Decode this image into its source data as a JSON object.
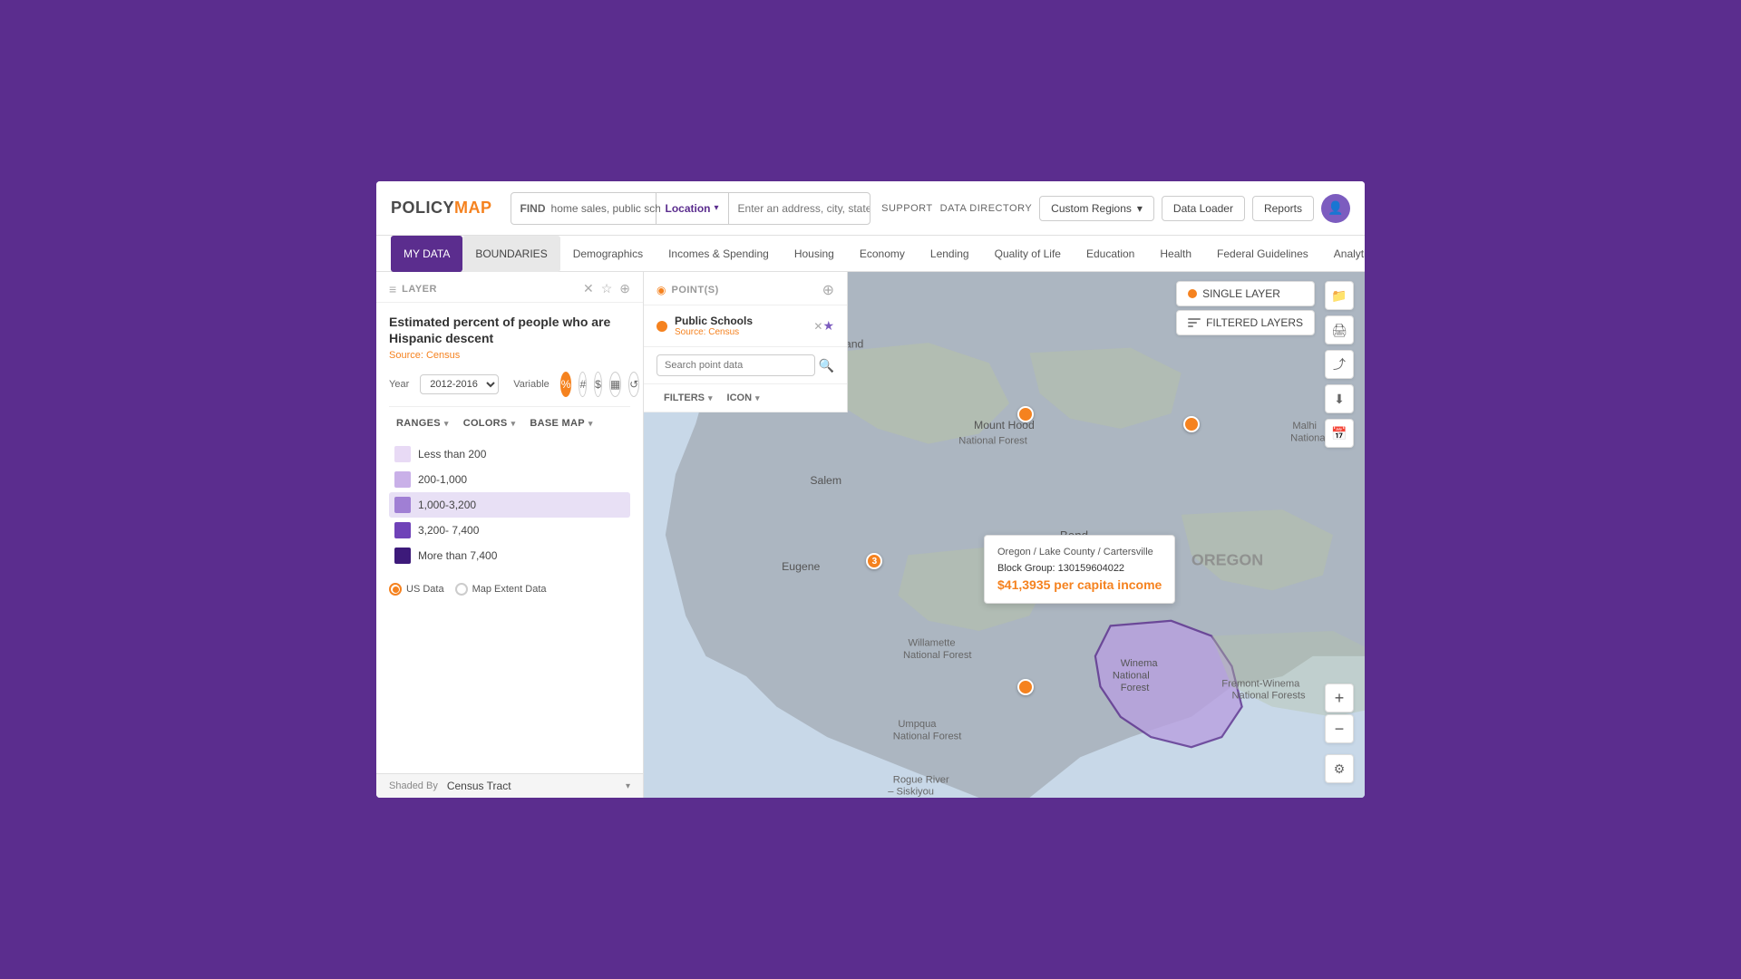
{
  "app": {
    "name": "POLICY",
    "name_accent": "MAP"
  },
  "header": {
    "support_label": "SUPPORT",
    "data_directory_label": "DATA DIRECTORY",
    "find_label": "Find",
    "find_placeholder": "home sales, public school...",
    "location_label": "Location",
    "address_placeholder": "Enter an address, city, state, zip or coordinates",
    "custom_regions_label": "Custom Regions",
    "data_loader_label": "Data Loader",
    "reports_label": "Reports"
  },
  "nav": {
    "my_data": "MY DATA",
    "boundaries": "BOUNDARIES",
    "demographics": "Demographics",
    "incomes_spending": "Incomes & Spending",
    "housing": "Housing",
    "economy": "Economy",
    "lending": "Lending",
    "quality_of_life": "Quality of Life",
    "education": "Education",
    "health": "Health",
    "federal_guidelines": "Federal Guidelines",
    "analytics": "Analytics"
  },
  "layer_panel": {
    "title": "LAYER",
    "layer_name": "Estimated percent of people who are Hispanic descent",
    "source": "Source: Census",
    "year_label": "Year",
    "year_value": "2012-2016",
    "variable_label": "Variable",
    "ranges_label": "RANGES",
    "colors_label": "COLORS",
    "base_map_label": "BASE MAP",
    "ranges": [
      {
        "label": "Less than 200",
        "color": "#e8daf5",
        "highlighted": false
      },
      {
        "label": "200-1,000",
        "color": "#c9b0e8",
        "highlighted": false
      },
      {
        "label": "1,000-3,200",
        "color": "#a07fd4",
        "highlighted": true
      },
      {
        "label": "3,200- 7,400",
        "color": "#6f42b8",
        "highlighted": false
      },
      {
        "label": "More than 7,400",
        "color": "#3d1a7a",
        "highlighted": false
      }
    ],
    "us_data_label": "US Data",
    "map_extent_label": "Map Extent Data",
    "shaded_by_label": "Shaded By",
    "shaded_by_value": "Census Tract"
  },
  "points_panel": {
    "title": "POINT(S)",
    "school_name": "Public Schools",
    "school_source": "Source: Census",
    "search_placeholder": "Search point data",
    "filters_label": "FILTERS",
    "icon_label": "ICON"
  },
  "map": {
    "tooltip_location": "Oregon / Lake County / Cartersville",
    "tooltip_block": "Block Group: 130159604022",
    "tooltip_value": "$41,3935 per capita income",
    "single_layer_label": "SINGLE LAYER",
    "filtered_layers_label": "FILTERED LAYERS",
    "region_label": "OREGON"
  }
}
